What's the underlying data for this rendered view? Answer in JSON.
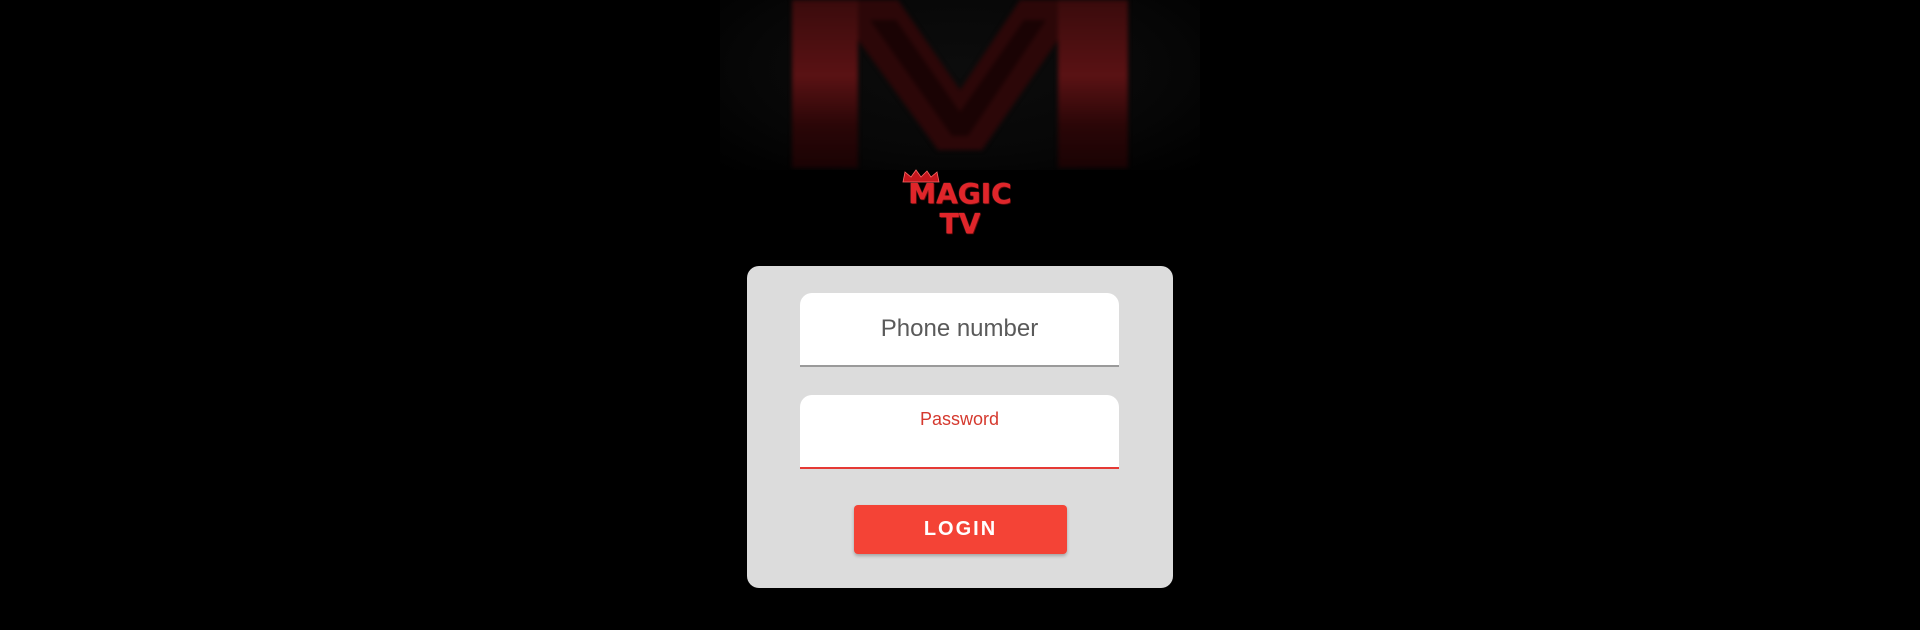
{
  "background_logo": {
    "letter": "M",
    "icon": "magic-tv-m-logo"
  },
  "brand": {
    "line1": "MAGIC",
    "line2": "TV",
    "icon": "crown-icon"
  },
  "login_form": {
    "phone_placeholder": "Phone number",
    "password_label": "Password",
    "login_label": "LOGIN"
  },
  "colors": {
    "background": "#000000",
    "card": "#dcdcdc",
    "accent": "#f44336",
    "brand_red": "#e0252a"
  }
}
